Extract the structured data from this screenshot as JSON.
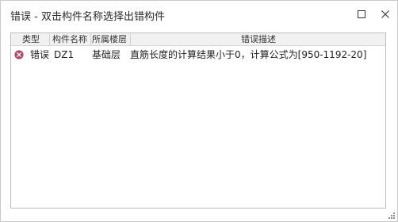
{
  "window": {
    "title": "错误 - 双击构件名称选择出错构件",
    "buttons": [
      "maximize",
      "close"
    ]
  },
  "table": {
    "columns": [
      "类型",
      "构件名称",
      "所属楼层",
      "错误描述"
    ],
    "rows": [
      {
        "icon": "error-x-icon",
        "type": "错误",
        "name": "DZ1",
        "floor": "基础层",
        "description": "直筋长度的计算结果小于0，计算公式为[950-1192-20]"
      }
    ]
  },
  "colors": {
    "error_icon": "#b04a68",
    "header_bg": "#f1f1f1",
    "border": "#bdbdbd"
  }
}
